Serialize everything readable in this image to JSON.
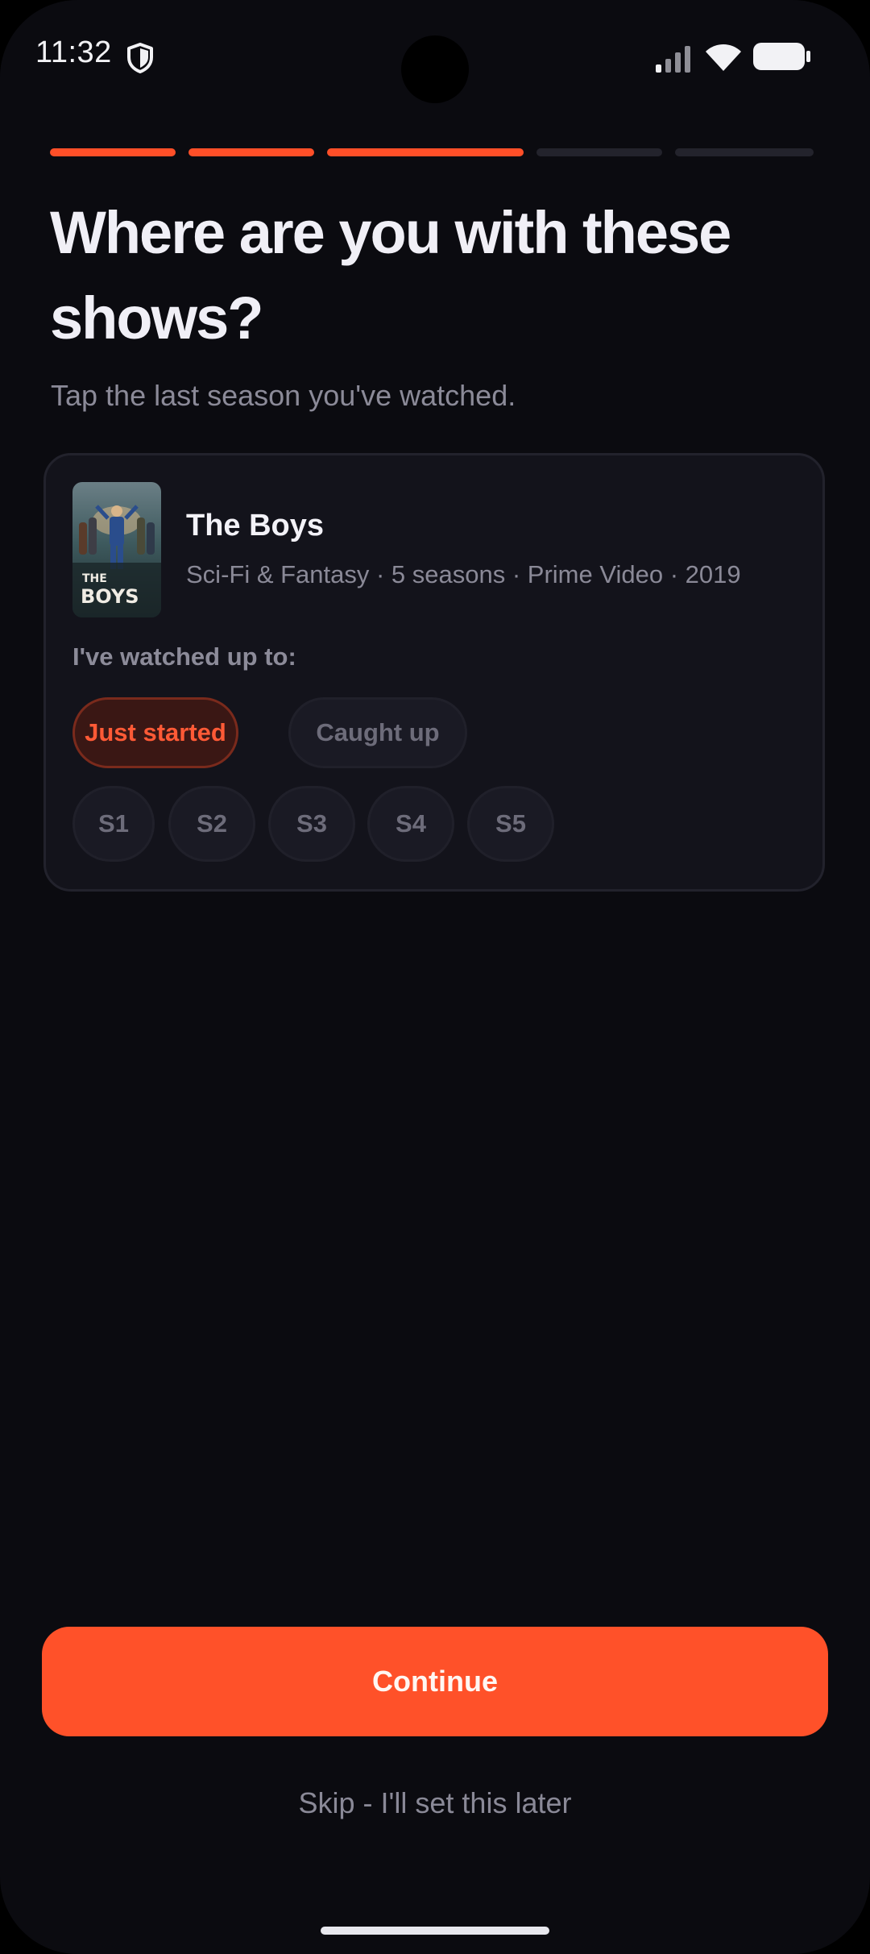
{
  "status_bar": {
    "time": "11:32",
    "icons": [
      "shield-icon",
      "cellular-signal-icon",
      "wifi-icon",
      "battery-icon"
    ]
  },
  "progress": {
    "total_steps": 5,
    "completed_steps": 3,
    "active_color": "#ff4f28",
    "inactive_color": "#23232c"
  },
  "header": {
    "title": "Where are you with these shows?",
    "subtitle": "Tap the last season you've watched."
  },
  "show": {
    "title": "The Boys",
    "meta": "Sci-Fi & Fantasy · 5 seasons · Prime Video · 2019",
    "poster_icon": "the-boys-poster",
    "watched_label": "I've watched up to:",
    "status_options": [
      {
        "label": "Just started",
        "selected": true
      },
      {
        "label": "Caught up",
        "selected": false
      }
    ],
    "seasons": [
      "S1",
      "S2",
      "S3",
      "S4",
      "S5"
    ]
  },
  "footer": {
    "continue_label": "Continue",
    "skip_label": "Skip - I'll set this later"
  },
  "colors": {
    "accent": "#ff5129",
    "background": "#0b0b10",
    "card": "#13131b"
  }
}
